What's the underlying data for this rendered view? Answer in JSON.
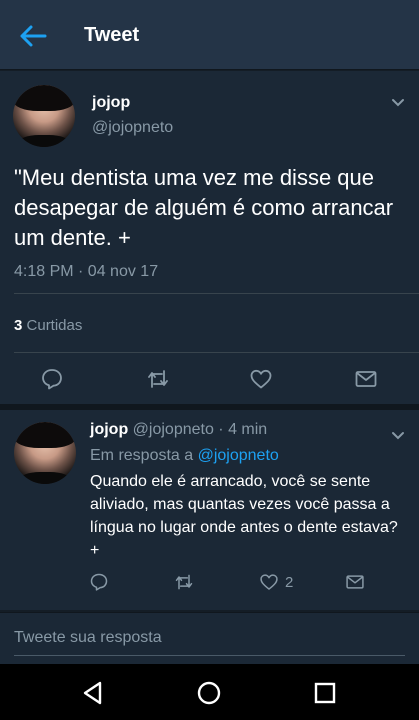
{
  "header": {
    "title": "Tweet"
  },
  "tweet": {
    "name": "jojop",
    "handle": "@jojopneto",
    "text": "\"Meu dentista uma vez me disse que desapegar de alguém é como arrancar um dente. +",
    "timestamp": "4:18 PM · 04 nov 17",
    "likes_count": "3",
    "likes_label": "Curtidas"
  },
  "reply": {
    "name": "jojop",
    "handle_time": "@jojopneto · 4 min",
    "reply_prefix": "Em resposta a",
    "reply_mention": "@jojopneto",
    "text": "Quando ele é arrancado, você se sente aliviado, mas quantas vezes você passa a língua no lugar onde antes o dente estava? +",
    "like_count": "2"
  },
  "compose": {
    "placeholder": "Tweete sua resposta"
  },
  "colors": {
    "accent": "#1da1f2",
    "background": "#141d26",
    "card": "#1b2836",
    "muted": "#8899a6"
  },
  "icons": [
    "back-arrow-icon",
    "chevron-down-icon",
    "reply-icon",
    "retweet-icon",
    "heart-icon",
    "share-icon",
    "nav-back-icon",
    "nav-home-icon",
    "nav-recents-icon"
  ]
}
